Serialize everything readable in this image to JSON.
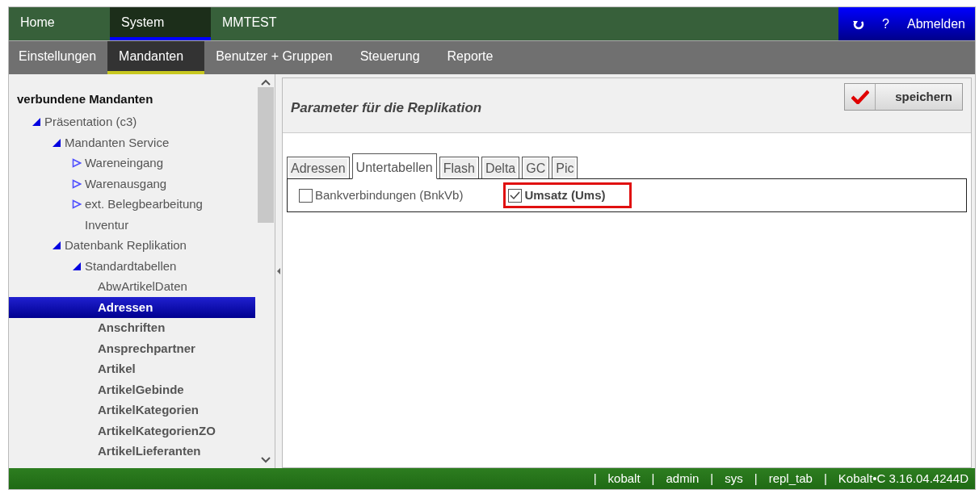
{
  "top_nav": [
    {
      "label": "Home",
      "selected": false
    },
    {
      "label": "System",
      "selected": true
    },
    {
      "label": "MMTEST",
      "selected": false
    }
  ],
  "top_actions": {
    "help": "?",
    "logout": "Abmelden"
  },
  "sub_nav": [
    {
      "label": "Einstellungen",
      "selected": false
    },
    {
      "label": "Mandanten",
      "selected": true
    },
    {
      "label": "Benutzer + Gruppen",
      "selected": false
    },
    {
      "label": "Steuerung",
      "selected": false
    },
    {
      "label": "Reporte",
      "selected": false
    }
  ],
  "sidebar": {
    "title": "verbundene Mandanten",
    "tree": [
      {
        "label": "Präsentation (c3)",
        "expanded": true,
        "children": [
          {
            "label": "Mandanten Service",
            "expanded": true,
            "children": [
              {
                "label": "Wareneingang",
                "expanded": false
              },
              {
                "label": "Warenausgang",
                "expanded": false
              },
              {
                "label": "ext. Belegbearbeitung",
                "expanded": false
              },
              {
                "label": "Inventur"
              }
            ]
          },
          {
            "label": "Datenbank Replikation",
            "expanded": true,
            "children": [
              {
                "label": "Standardtabellen",
                "expanded": true,
                "children": [
                  {
                    "label": "AbwArtikelDaten",
                    "bold": false,
                    "selected": false
                  },
                  {
                    "label": "Adressen",
                    "bold": true,
                    "selected": true
                  },
                  {
                    "label": "Anschriften",
                    "bold": true,
                    "selected": false
                  },
                  {
                    "label": "Ansprechpartner",
                    "bold": true,
                    "selected": false
                  },
                  {
                    "label": "Artikel",
                    "bold": true,
                    "selected": false
                  },
                  {
                    "label": "ArtikelGebinde",
                    "bold": true,
                    "selected": false
                  },
                  {
                    "label": "ArtikelKategorien",
                    "bold": true,
                    "selected": false
                  },
                  {
                    "label": "ArtikelKategorienZO",
                    "bold": true,
                    "selected": false
                  },
                  {
                    "label": "ArtikelLieferanten",
                    "bold": true,
                    "selected": false
                  }
                ]
              }
            ]
          }
        ]
      }
    ]
  },
  "panel": {
    "title": "Parameter für die Replikation",
    "save_button": "speichern",
    "tabs": [
      {
        "label": "Adressen",
        "selected": false
      },
      {
        "label": "Untertabellen",
        "selected": true
      },
      {
        "label": "Flash",
        "selected": false
      },
      {
        "label": "Delta",
        "selected": false
      },
      {
        "label": "GC",
        "selected": false
      },
      {
        "label": "Pic",
        "selected": false
      }
    ],
    "options": [
      {
        "label": "Bankverbindungen (BnkVb)",
        "checked": false,
        "highlighted": false
      },
      {
        "label": "Umsatz (Ums)",
        "checked": true,
        "highlighted": true
      }
    ]
  },
  "status_bar": [
    "|",
    "kobalt",
    "|",
    "admin",
    "|",
    "sys",
    "|",
    "repl_tab",
    "|",
    "Kobalt•C 3.16.04.4244D"
  ]
}
